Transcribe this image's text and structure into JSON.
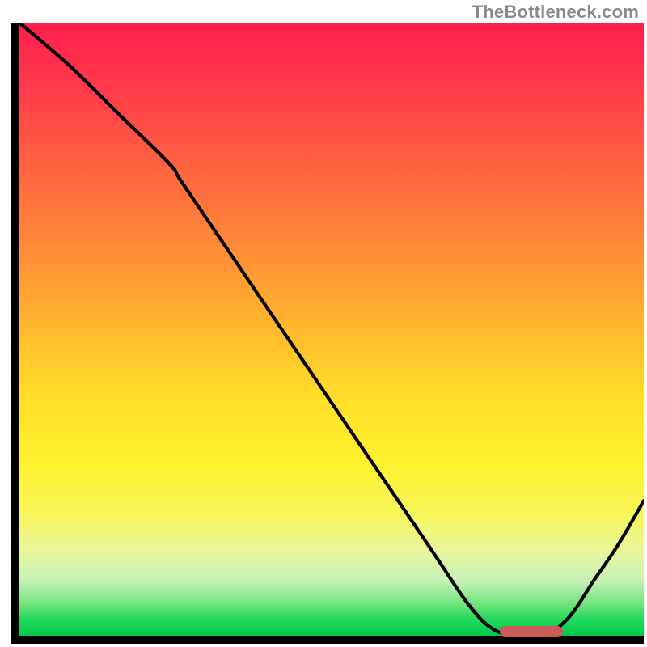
{
  "attribution": "TheBottleneck.com",
  "chart_data": {
    "type": "line",
    "title": "",
    "xlabel": "",
    "ylabel": "",
    "xlim": [
      0,
      100
    ],
    "ylim": [
      0,
      100
    ],
    "series": [
      {
        "name": "curve",
        "x": [
          0,
          8,
          16,
          24,
          26,
          34,
          42,
          50,
          58,
          66,
          72,
          76,
          80,
          84,
          88,
          92,
          96,
          100
        ],
        "y": [
          100,
          93,
          85,
          77,
          74,
          62,
          50,
          38,
          26,
          14,
          5,
          1,
          0,
          0,
          3,
          9,
          15,
          22
        ]
      }
    ],
    "marker": {
      "x_start": 77,
      "x_end": 87,
      "y": 0.6
    },
    "gradient_stops": [
      {
        "pos": 0,
        "color": "#ff1f4d"
      },
      {
        "pos": 12,
        "color": "#ff3e49"
      },
      {
        "pos": 26,
        "color": "#ff6b3f"
      },
      {
        "pos": 38,
        "color": "#ff8f36"
      },
      {
        "pos": 50,
        "color": "#ffb92d"
      },
      {
        "pos": 62,
        "color": "#ffe028"
      },
      {
        "pos": 72,
        "color": "#fff22f"
      },
      {
        "pos": 80,
        "color": "#f8f65a"
      },
      {
        "pos": 86,
        "color": "#e9f69b"
      },
      {
        "pos": 91,
        "color": "#c8f1b8"
      },
      {
        "pos": 95,
        "color": "#6de47a"
      },
      {
        "pos": 97.5,
        "color": "#1ed85b"
      },
      {
        "pos": 100,
        "color": "#00c94a"
      }
    ]
  }
}
